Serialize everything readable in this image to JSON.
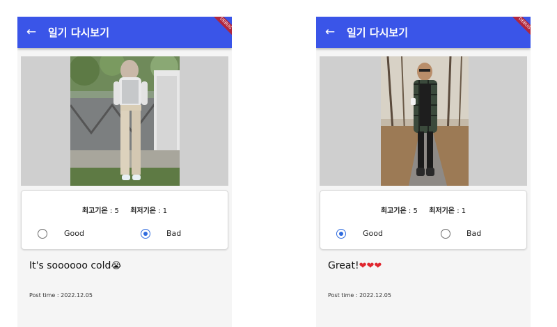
{
  "screens": [
    {
      "title": "일기 다시보기",
      "debug_banner": "DEBUG",
      "max_temp_label": "최고기온",
      "max_temp_value": ": 5",
      "min_temp_label": "최저기온",
      "min_temp_value": ": 1",
      "options": [
        {
          "label": "Good",
          "selected": false
        },
        {
          "label": "Bad",
          "selected": true
        }
      ],
      "diary_text": "It's soooooo cold",
      "diary_emoji": "😭",
      "post_time": "Post time : 2022.12.05"
    },
    {
      "title": "일기 다시보기",
      "debug_banner": "DEBUG",
      "max_temp_label": "최고기온",
      "max_temp_value": ": 5",
      "min_temp_label": "최저기온",
      "min_temp_value": ": 1",
      "options": [
        {
          "label": "Good",
          "selected": true
        },
        {
          "label": "Bad",
          "selected": false
        }
      ],
      "diary_text": "Great!",
      "diary_emoji": "❤❤❤",
      "post_time": "Post time : 2022.12.05"
    }
  ],
  "colors": {
    "appbar": "#3a55e8",
    "radio_selected": "#2f6bde",
    "photo_background": "#cfcfcf"
  }
}
